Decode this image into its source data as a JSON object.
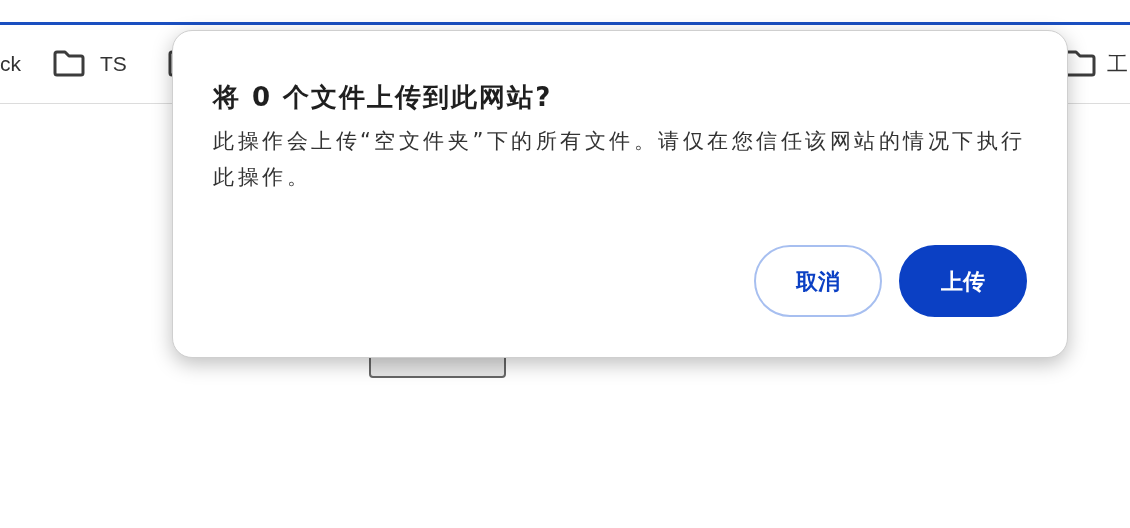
{
  "bookmarks": [
    {
      "label": "ck",
      "icon": false
    },
    {
      "label": "TS",
      "icon": true
    },
    {
      "icon": true
    },
    {
      "label": "工",
      "icon": true
    }
  ],
  "dialog": {
    "title": "将 0 个文件上传到此网站?",
    "message": "此操作会上传“空文件夹”下的所有文件。请仅在您信任该网站的情况下执行此操作。",
    "buttons": [
      {
        "label": "取消",
        "kind": "secondary"
      },
      {
        "label": "上传",
        "kind": "primary"
      }
    ]
  }
}
